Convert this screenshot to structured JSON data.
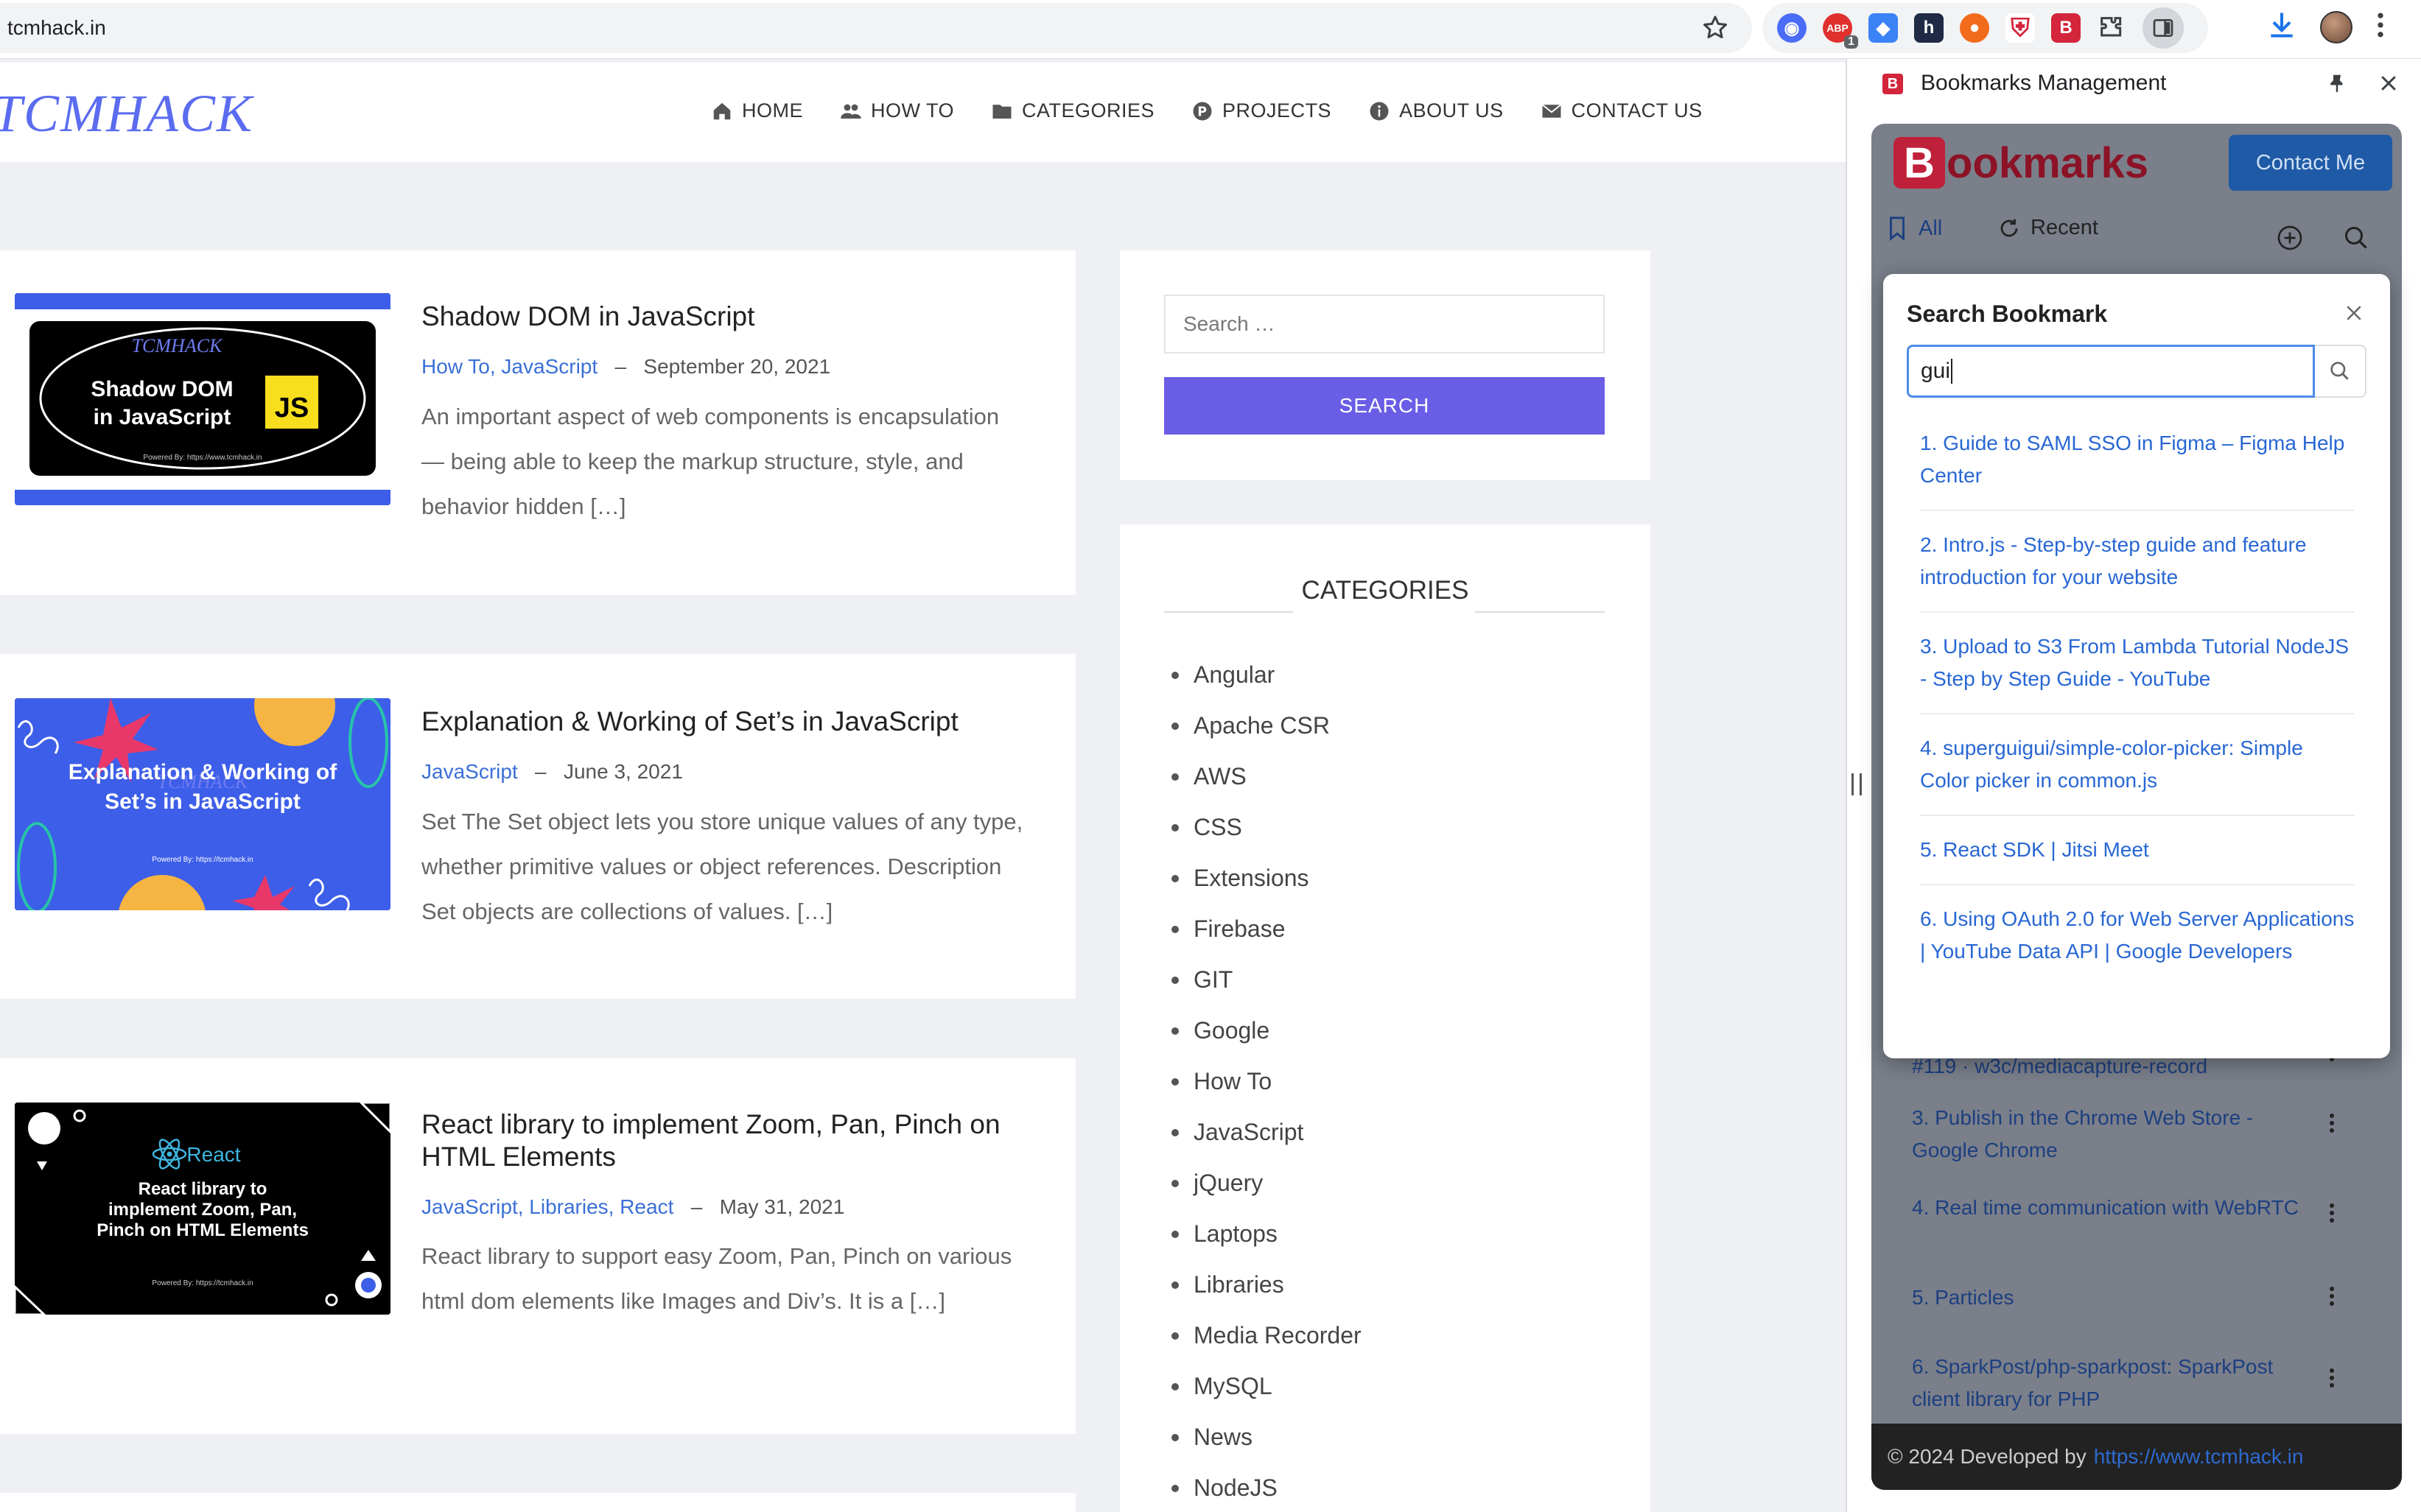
{
  "browser": {
    "url": "tcmhack.in",
    "extensions": [
      {
        "name": "extension-blue",
        "color": "#4a6cf7",
        "glyph": "◉"
      },
      {
        "name": "extension-adblock",
        "color": "#e0302e",
        "glyph": "ABP",
        "count": "1"
      },
      {
        "name": "extension-translate",
        "color": "#3b82f6",
        "glyph": "◆"
      },
      {
        "name": "extension-h",
        "color": "#1f2a44",
        "glyph": "h"
      },
      {
        "name": "extension-color",
        "color": "#f26b1d",
        "glyph": "●"
      },
      {
        "name": "extension-shield",
        "color": "#d3253b",
        "glyph": "⛨"
      },
      {
        "name": "extension-bookmarks",
        "color": "#d3253b",
        "glyph": "B"
      },
      {
        "name": "extension-puzzle",
        "color": "#5f6368",
        "glyph": "✱"
      }
    ]
  },
  "site": {
    "logo": "TCMHACK",
    "nav": [
      {
        "label": "HOME",
        "icon": "home-icon"
      },
      {
        "label": "HOW TO",
        "icon": "users-icon"
      },
      {
        "label": "CATEGORIES",
        "icon": "folder-icon"
      },
      {
        "label": "PROJECTS",
        "icon": "projects-icon"
      },
      {
        "label": "ABOUT US",
        "icon": "info-icon"
      },
      {
        "label": "CONTACT US",
        "icon": "mail-icon"
      }
    ]
  },
  "posts": [
    {
      "title": "Shadow DOM in JavaScript",
      "categories": "How To, JavaScript",
      "date": "September 20, 2021",
      "excerpt": "An important aspect of web components is encapsulation — being able to keep the markup structure, style, and behavior hidden […]",
      "thumb_brand": "TCMHACK",
      "thumb_title_1": "Shadow DOM",
      "thumb_title_2": "in JavaScript",
      "thumb_badge": "JS",
      "thumb_footer": "Powered By: https://www.tcmhack.in"
    },
    {
      "title": "Explanation & Working of Set’s in JavaScript",
      "categories": "JavaScript",
      "date": "June 3, 2021",
      "excerpt": "Set The Set object lets you store unique values of any type, whether primitive values or object references. Description Set objects are collections of values. […]",
      "thumb_brand": "TCMHACK",
      "thumb_title_1": "Explanation & Working of",
      "thumb_title_2": "Set’s in JavaScript",
      "thumb_footer": "Powered By: https://tcmhack.in"
    },
    {
      "title": "React library to implement Zoom, Pan, Pinch on HTML Elements",
      "categories": "JavaScript, Libraries, React",
      "date": "May 31, 2021",
      "excerpt": "React library to support easy Zoom, Pan, Pinch on various html dom elements like Images and Div’s. It is a […]",
      "thumb_brand": "React",
      "thumb_title_1": "React library to",
      "thumb_title_2": "implement Zoom, Pan,",
      "thumb_title_3": "Pinch on HTML Elements",
      "thumb_footer": "Powered By: https://tcmhack.in"
    }
  ],
  "sidebar": {
    "search_placeholder": "Search …",
    "search_button": "SEARCH",
    "categories_heading": "CATEGORIES",
    "categories": [
      "Angular",
      "Apache CSR",
      "AWS",
      "CSS",
      "Extensions",
      "Firebase",
      "GIT",
      "Google",
      "How To",
      "JavaScript",
      "jQuery",
      "Laptops",
      "Libraries",
      "Media Recorder",
      "MySQL",
      "News",
      "NodeJS"
    ]
  },
  "side_panel": {
    "title": "Bookmarks Management",
    "brand_first": "B",
    "brand_rest": "ookmarks",
    "contact_button": "Contact Me",
    "tab_all": "All",
    "tab_recent": "Recent",
    "background_items": [
      "#119 · w3c/mediacapture-record",
      "3. Publish in the Chrome Web Store - Google Chrome",
      "4. Real time communication with WebRTC",
      "5. Particles",
      "6. SparkPost/php-sparkpost: SparkPost client library for PHP"
    ],
    "footer_text": "© 2024 Developed by",
    "footer_link": "https://www.tcmhack.in"
  },
  "search_modal": {
    "title": "Search Bookmark",
    "query": "gui",
    "results": [
      "1. Guide to SAML SSO in Figma – Figma Help Center",
      "2. Intro.js - Step-by-step guide and feature introduction for your website",
      "3. Upload to S3 From Lambda Tutorial NodeJS - Step by Step Guide - YouTube",
      "4. superguigui/simple-color-picker: Simple Color picker in common.js",
      "5. React SDK | Jitsi Meet",
      "6. Using OAuth 2.0 for Web Server Applications  |  YouTube Data API  |  Google Developers"
    ]
  }
}
